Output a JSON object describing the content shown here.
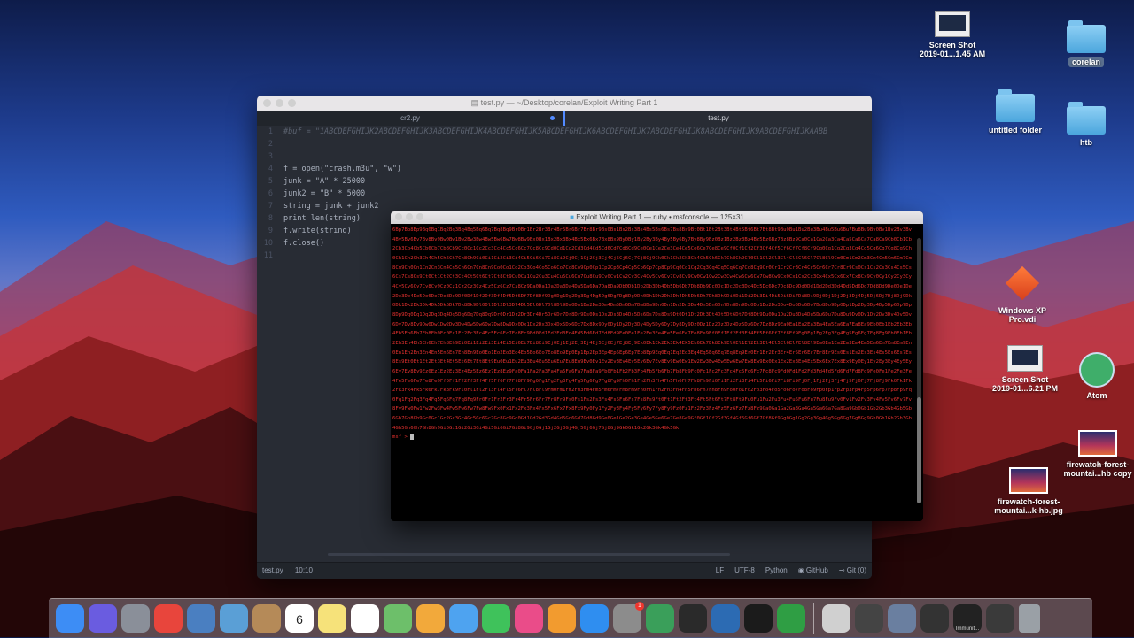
{
  "desktop": {
    "icons": [
      {
        "label": "Screen Shot\n2019-01...1.45 AM"
      },
      {
        "label": "corelan"
      },
      {
        "label": "untitled folder"
      },
      {
        "label": "htb"
      },
      {
        "label": "Windows XP\nPro.vdi"
      },
      {
        "label": "Screen Shot\n2019-01...6.21 PM"
      },
      {
        "label": "Atom"
      },
      {
        "label": "firewatch-forest-\nmountai...hb copy"
      },
      {
        "label": "firewatch-forest-\nmountai...k-hb.jpg"
      }
    ]
  },
  "editor": {
    "title": "test.py — ~/Desktop/corelan/Exploit Writing Part 1",
    "tabs": [
      {
        "label": "cr2.py"
      },
      {
        "label": "test.py"
      }
    ],
    "lines": [
      {
        "n": "1",
        "text": "#buf = \"1ABCDEFGHIJK2ABCDEFGHIJK3ABCDEFGHIJK4ABCDEFGHIJK5ABCDEFGHIJK6ABCDEFGHIJK7ABCDEFGHIJK8ABCDEFGHIJK9ABCDEFGHIJKAABB"
      },
      {
        "n": "2",
        "text": ""
      },
      {
        "n": "3",
        "text": ""
      },
      {
        "n": "4",
        "text": "f = open(\"crash.m3u\", \"w\")"
      },
      {
        "n": "5",
        "text": "junk = \"A\" * 25000"
      },
      {
        "n": "6",
        "text": "junk2 = \"B\" * 5000"
      },
      {
        "n": "7",
        "text": "string = junk + junk2"
      },
      {
        "n": "8",
        "text": "print len(string)"
      },
      {
        "n": "9",
        "text": "f.write(string)"
      },
      {
        "n": "10",
        "text": "f.close()"
      },
      {
        "n": "11",
        "text": ""
      }
    ],
    "status": {
      "file": "test.py",
      "position": "10:10",
      "eol": "LF",
      "encoding": "UTF-8",
      "grammar": "Python",
      "github": "GitHub",
      "git": "Git (0)"
    }
  },
  "terminal": {
    "title": "Exploit Writing Part 1 — ruby • msfconsole — 125×31",
    "output": "6Bp7Bp8Bp9Bq0Bq1Bq2Bq3Bq4Bq5Bq6Bq7Bq8Bq9Br0Br1Br2Br3Br4Br5Br6Br7Br8Br9Bs0Bs1Bs2Bs3Bs4Bs5Bs6Bs7Bs8Bs9Bt0Bt1Bt2Bt3Bt4Bt5Bt6Bt7Bt8Bt9Bu0Bu1Bu2Bu3Bu4Bu5Bu6Bu7Bu8Bu9Bv0Bv1Bv2Bv3Bv4Bv5Bv6Bv7Bv8Bv9Bw0Bw1Bw2Bw3Bw4Bw5Bw6Bw7Bw8Bw9Bx0Bx1Bx2Bx3Bx4Bx5Bx6Bx7Bx8Bx9By0By1By2By3By4By5By6By7By8By9Bz0Bz1Bz2Bz3Bz4Bz5Bz6Bz7Bz8Bz9Ca0Ca1Ca2Ca3Ca4Ca5Ca6Ca7Ca8Ca9Cb0Cb1Cb2Cb3Cb4Cb5Cb6Cb7Cb8Cb9Cc0Cc1Cc2Cc3Cc4Cc5Cc6Cc7Cc8Cc9Cd0Cd1Cd2Cd3Cd4Cd5Cd6Cd7Cd8Cd9Ce0Ce1Ce2Ce3Ce4Ce5Ce6Ce7Ce8Ce9Cf0Cf1Cf2Cf3Cf4Cf5Cf6Cf7Cf8Cf9Cg0Cg1Cg2Cg3Cg4Cg5Cg6Cg7Cg8Cg9Ch0Ch1Ch2Ch3Ch4Ch5Ch6Ch7Ch8Ch9Ci0Ci1Ci2Ci3Ci4Ci5Ci6Ci7Ci8Ci9Cj0Cj1Cj2Cj3Cj4Cj5Cj6Cj7Cj8Cj9Ck0Ck1Ck2Ck3Ck4Ck5Ck6Ck7Ck8Ck9Cl0Cl1Cl2Cl3Cl4Cl5Cl6Cl7Cl8Cl9Cm0Cm1Cm2Cm3Cm4Cm5Cm6Cm7Cm8Cm9Cn0Cn1Cn2Cn3Cn4Cn5Cn6Cn7Cn8Cn9Co0Co1Co2Co3Co4Co5Co6Co7Co8Co9Cp0Cp1Cp2Cp3Cp4Cp5Cp6Cp7Cp8Cp9Cq0Cq1Cq2Cq3Cq4Cq5Cq6Cq7Cq8Cq9Cr0Cr1Cr2Cr3Cr4Cr5Cr6Cr7Cr8Cr9Cs0Cs1Cs2Cs3Cs4Cs5Cs6Cs7Cs8Cs9Ct0Ct1Ct2Ct3Ct4Ct5Ct6Ct7Ct8Ct9Cu0Cu1Cu2Cu3Cu4Cu5Cu6Cu7Cu8Cu9Cv0Cv1Cv2Cv3Cv4Cv5Cv6Cv7Cv8Cv9Cw0Cw1Cw2Cw3Cw4Cw5Cw6Cw7Cw8Cw9Cx0Cx1Cx2Cx3Cx4Cx5Cx6Cx7Cx8Cx9Cy0Cy1Cy2Cy3Cy4Cy5Cy6Cy7Cy8Cy9Cz0Cz1Cz2Cz3Cz4Cz5Cz6Cz7Cz8Cz9Da0Da1Da2Da3Da4Da5Da6Da7Da8Da9Db0Db1Db2Db3Db4Db5Db6Db7Db8Db9Dc0Dc1Dc2Dc3Dc4Dc5Dc6Dc7Dc8Dc9Dd0Dd1Dd2Dd3Dd4Dd5Dd6Dd7Dd8Dd9De0De1De2De3De4De5De6De7De8De9Df0Df1Df2Df3Df4Df5Df6Df7Df8Df9Dg0Dg1Dg2Dg3Dg4Dg5Dg6Dg7Dg8Dg9Dh0Dh1Dh2Dh3Dh4Dh5Dh6Dh7Dh8Dh9Di0Di1Di2Di3Di4Di5Di6Di7Di8Di9Dj0Dj1Dj2Dj3Dj4Dj5Dj6Dj7Dj8Dj9Dk0Dk1Dk2Dk3Dk4Dk5Dk6Dk7Dk8Dk9Dl0Dl1Dl2Dl3Dl4Dl5Dl6Dl7Dl8Dl9Dm0Dm1Dm2Dm3Dm4Dm5Dm6Dm7Dm8Dm9Dn0Dn1Dn2Dn3Dn4Dn5Dn6Dn7Dn8Dn9Do0Do1Do2Do3Do4Do5Do6Do7Do8Do9Dp0Dp1Dp2Dp3Dp4Dp5Dp6Dp7Dp8Dp9Dq0Dq1Dq2Dq3Dq4Dq5Dq6Dq7Dq8Dq9Dr0Dr1Dr2Dr3Dr4Dr5Dr6Dr7Dr8Dr9Ds0Ds1Ds2Ds3Ds4Ds5Ds6Ds7Ds8Ds9Dt0Dt1Dt2Dt3Dt4Dt5Dt6Dt7Dt8Dt9Du0Du1Du2Du3Du4Du5Du6Du7Du8Du9Dv0Dv1Dv2Dv3Dv4Dv5Dv6Dv7Dv8Dv9Dw0Dw1Dw2Dw3Dw4Dw5Dw6Dw7Dw8Dw9Dx0Dx1Dx2Dx3Dx4Dx5Dx6Dx7Dx8Dx9Dy0Dy1Dy2Dy3Dy4Dy5Dy6Dy7Dy8Dy9Dz0Dz1Dz2Dz3Dz4Dz5Dz6Dz7Dz8Dz9Ea0Ea1Ea2Ea3Ea4Ea5Ea6Ea7Ea8Ea9Eb0Eb1Eb2Eb3Eb4Eb5Eb6Eb7Eb8Eb9Ec0Ec1Ec2Ec3Ec4Ec5Ec6Ec7Ec8Ec9Ed0Ed1Ed2Ed3Ed4Ed5Ed6Ed7Ed8Ed9Ee0Ee1Ee2Ee3Ee4Ee5Ee6Ee7Ee8Ee9Ef0Ef1Ef2Ef3Ef4Ef5Ef6Ef7Ef8Ef9Eg0Eg1Eg2Eg3Eg4Eg5Eg6Eg7Eg8Eg9Eh0Eh1Eh2Eh3Eh4Eh5Eh6Eh7Eh8Eh9Ei0Ei1Ei2Ei3Ei4Ei5Ei6Ei7Ei8Ei9Ej0Ej1Ej2Ej3Ej4Ej5Ej6Ej7Ej8Ej9Ek0Ek1Ek2Ek3Ek4Ek5Ek6Ek7Ek8Ek9El0El1El2El3El4El5El6El7El8El9Em0Em1Em2Em3Em4Em5Em6Em7Em8Em9En0En1En2En3En4En5En6En7En8En9Eo0Eo1Eo2Eo3Eo4Eo5Eo6Eo7Eo8Eo9Ep0Ep1Ep2Ep3Ep4Ep5Ep6Ep7Ep8Ep9Eq0Eq1Eq2Eq3Eq4Eq5Eq6Eq7Eq8Eq9Er0Er1Er2Er3Er4Er5Er6Er7Er8Er9Es0Es1Es2Es3Es4Es5Es6Es7Es8Es9Et0Et1Et2Et3Et4Et5Et6Et7Et8Et9Eu0Eu1Eu2Eu3Eu4Eu5Eu6Eu7Eu8Eu9Ev0Ev1Ev2Ev3Ev4Ev5Ev6Ev7Ev8Ev9Ew0Ew1Ew2Ew3Ew4Ew5Ew6Ew7Ew8Ew9Ex0Ex1Ex2Ex3Ex4Ex5Ex6Ex7Ex8Ex9Ey0Ey1Ey2Ey3Ey4Ey5Ey6Ey7Ey8Ey9Ez0Ez1Ez2Ez3Ez4Ez5Ez6Ez7Ez8Ez9Fa0Fa1Fa2Fa3Fa4Fa5Fa6Fa7Fa8Fa9Fb0Fb1Fb2Fb3Fb4Fb5Fb6Fb7Fb8Fb9Fc0Fc1Fc2Fc3Fc4Fc5Fc6Fc7Fc8Fc9Fd0Fd1Fd2Fd3Fd4Fd5Fd6Fd7Fd8Fd9Fe0Fe1Fe2Fe3Fe4Fe5Fe6Fe7Fe8Fe9Ff0Ff1Ff2Ff3Ff4Ff5Ff6Ff7Ff8Ff9Fg0Fg1Fg2Fg3Fg4Fg5Fg6Fg7Fg8Fg9Fh0Fh1Fh2Fh3Fh4Fh5Fh6Fh7Fh8Fh9Fi0Fi1Fi2Fi3Fi4Fi5Fi6Fi7Fi8Fi9Fj0Fj1Fj2Fj3Fj4Fj5Fj6Fj7Fj8Fj9Fk0Fk1Fk2Fk3Fk4Fk5Fk6Fk7Fk8Fk9Fl0Fl1Fl2Fl3Fl4Fl5Fl6Fl7Fl8Fl9Fm0Fm1Fm2Fm3Fm4Fm5Fm6Fm7Fm8Fm9Fn0Fn1Fn2Fn3Fn4Fn5Fn6Fn7Fn8Fn9Fo0Fo1Fo2Fo3Fo4Fo5Fo6Fo7Fo8Fo9Fp0Fp1Fp2Fp3Fp4Fp5Fp6Fp7Fp8Fp9Fq0Fq1Fq2Fq3Fq4Fq5Fq6Fq7Fq8Fq9Fr0Fr1Fr2Fr3Fr4Fr5Fr6Fr7Fr8Fr9Fs0Fs1Fs2Fs3Fs4Fs5Fs6Fs7Fs8Fs9Ft0Ft1Ft2Ft3Ft4Ft5Ft6Ft7Ft8Ft9Fu0Fu1Fu2Fu3Fu4Fu5Fu6Fu7Fu8Fu9Fv0Fv1Fv2Fv3Fv4Fv5Fv6Fv7Fv8Fv9Fw0Fw1Fw2Fw3Fw4Fw5Fw6Fw7Fw8Fw9Fx0Fx1Fx2Fx3Fx4Fx5Fx6Fx7Fx8Fx9Fy0Fy1Fy2Fy3Fy4Fy5Fy6Fy7Fy8Fy9Fz0Fz1Fz2Fz3Fz4Fz5Fz6Fz7Fz8Fz9Ga0Ga1Ga2Ga3Ga4Ga5Ga6Ga7Ga8Ga9Gb0Gb1Gb2Gb3Gb4Gb5Gb6Gb7Gb8Gb9Gc0Gc1Gc2Gc3Gc4Gc5Gc6Gc7Gc8Gc9Gd0Gd1Gd2Gd3Gd4Gd5Gd6Gd7Gd8Gd9Ge0Ge1Ge2Ge3Ge4Ge5Ge6Ge7Ge8Ge9Gf0Gf1Gf2Gf3Gf4Gf5Gf6Gf7Gf8Gf9Gg0Gg1Gg2Gg3Gg4Gg5Gg6Gg7Gg8Gg9Gh0Gh1Gh2Gh3Gh4Gh5Gh6Gh7Gh8Gh9Gi0Gi1Gi2Gi3Gi4Gi5Gi6Gi7Gi8Gi9Gj0Gj1Gj2Gj3Gj4Gj5Gj6Gj7Gj8Gj9Gk0Gk1Gk2Gk3Gk4Gk5Gk",
    "prompt": "msf >"
  },
  "dock": {
    "apps": [
      {
        "icon": "finder-icon",
        "color": "#3d8df5"
      },
      {
        "icon": "siri-icon",
        "color": "#6a5ce0"
      },
      {
        "icon": "launchpad-icon",
        "color": "#8a8f99"
      },
      {
        "icon": "chrome-icon",
        "color": "#e8453c"
      },
      {
        "icon": "virtualbox-icon",
        "color": "#4a7fc1"
      },
      {
        "icon": "preview-icon",
        "color": "#5a9fd6"
      },
      {
        "icon": "contacts-icon",
        "color": "#b58a58"
      },
      {
        "icon": "calendar-icon",
        "color": "#ffffff",
        "badge_text": "6"
      },
      {
        "icon": "notes-icon",
        "color": "#f6e27a"
      },
      {
        "icon": "reminders-icon",
        "color": "#ffffff"
      },
      {
        "icon": "maps-icon",
        "color": "#6dbf6a"
      },
      {
        "icon": "photos-icon",
        "color": "#f2a93b"
      },
      {
        "icon": "messages-bubble-icon",
        "color": "#4ea3f0"
      },
      {
        "icon": "facetime-icon",
        "color": "#3fc25b"
      },
      {
        "icon": "itunes-icon",
        "color": "#ea4c89"
      },
      {
        "icon": "ibooks-icon",
        "color": "#f29b2f"
      },
      {
        "icon": "app-store-icon",
        "color": "#2f8ef0"
      },
      {
        "icon": "system-preferences-icon",
        "color": "#8c8c8c",
        "badge": "1"
      },
      {
        "icon": "atom-icon",
        "color": "#3a9f5a"
      },
      {
        "icon": "obs-icon",
        "color": "#2a2a2a"
      },
      {
        "icon": "edge-icon",
        "color": "#2c6bb3"
      },
      {
        "icon": "terminal-icon",
        "color": "#1b1b1b"
      },
      {
        "icon": "activity-monitor-icon",
        "color": "#2f9e44"
      }
    ],
    "others": [
      {
        "icon": "screenshot-thumb-icon",
        "color": "#d0d0d0"
      },
      {
        "icon": "window-thumb-icon",
        "color": "#444444"
      },
      {
        "icon": "window-thumb-icon",
        "color": "#6a7fa0"
      },
      {
        "icon": "window-thumb-icon",
        "color": "#333333"
      },
      {
        "icon": "immunity-thumb-icon",
        "color": "#222222",
        "label": "Immunit..."
      },
      {
        "icon": "window-thumb-icon",
        "color": "#3a3a3a"
      },
      {
        "icon": "trash-icon",
        "color": "#9aa0a6"
      }
    ]
  },
  "colors": {
    "terminal_text": "#e2302e",
    "editor_bg": "#282c34",
    "accent": "#528bff"
  }
}
